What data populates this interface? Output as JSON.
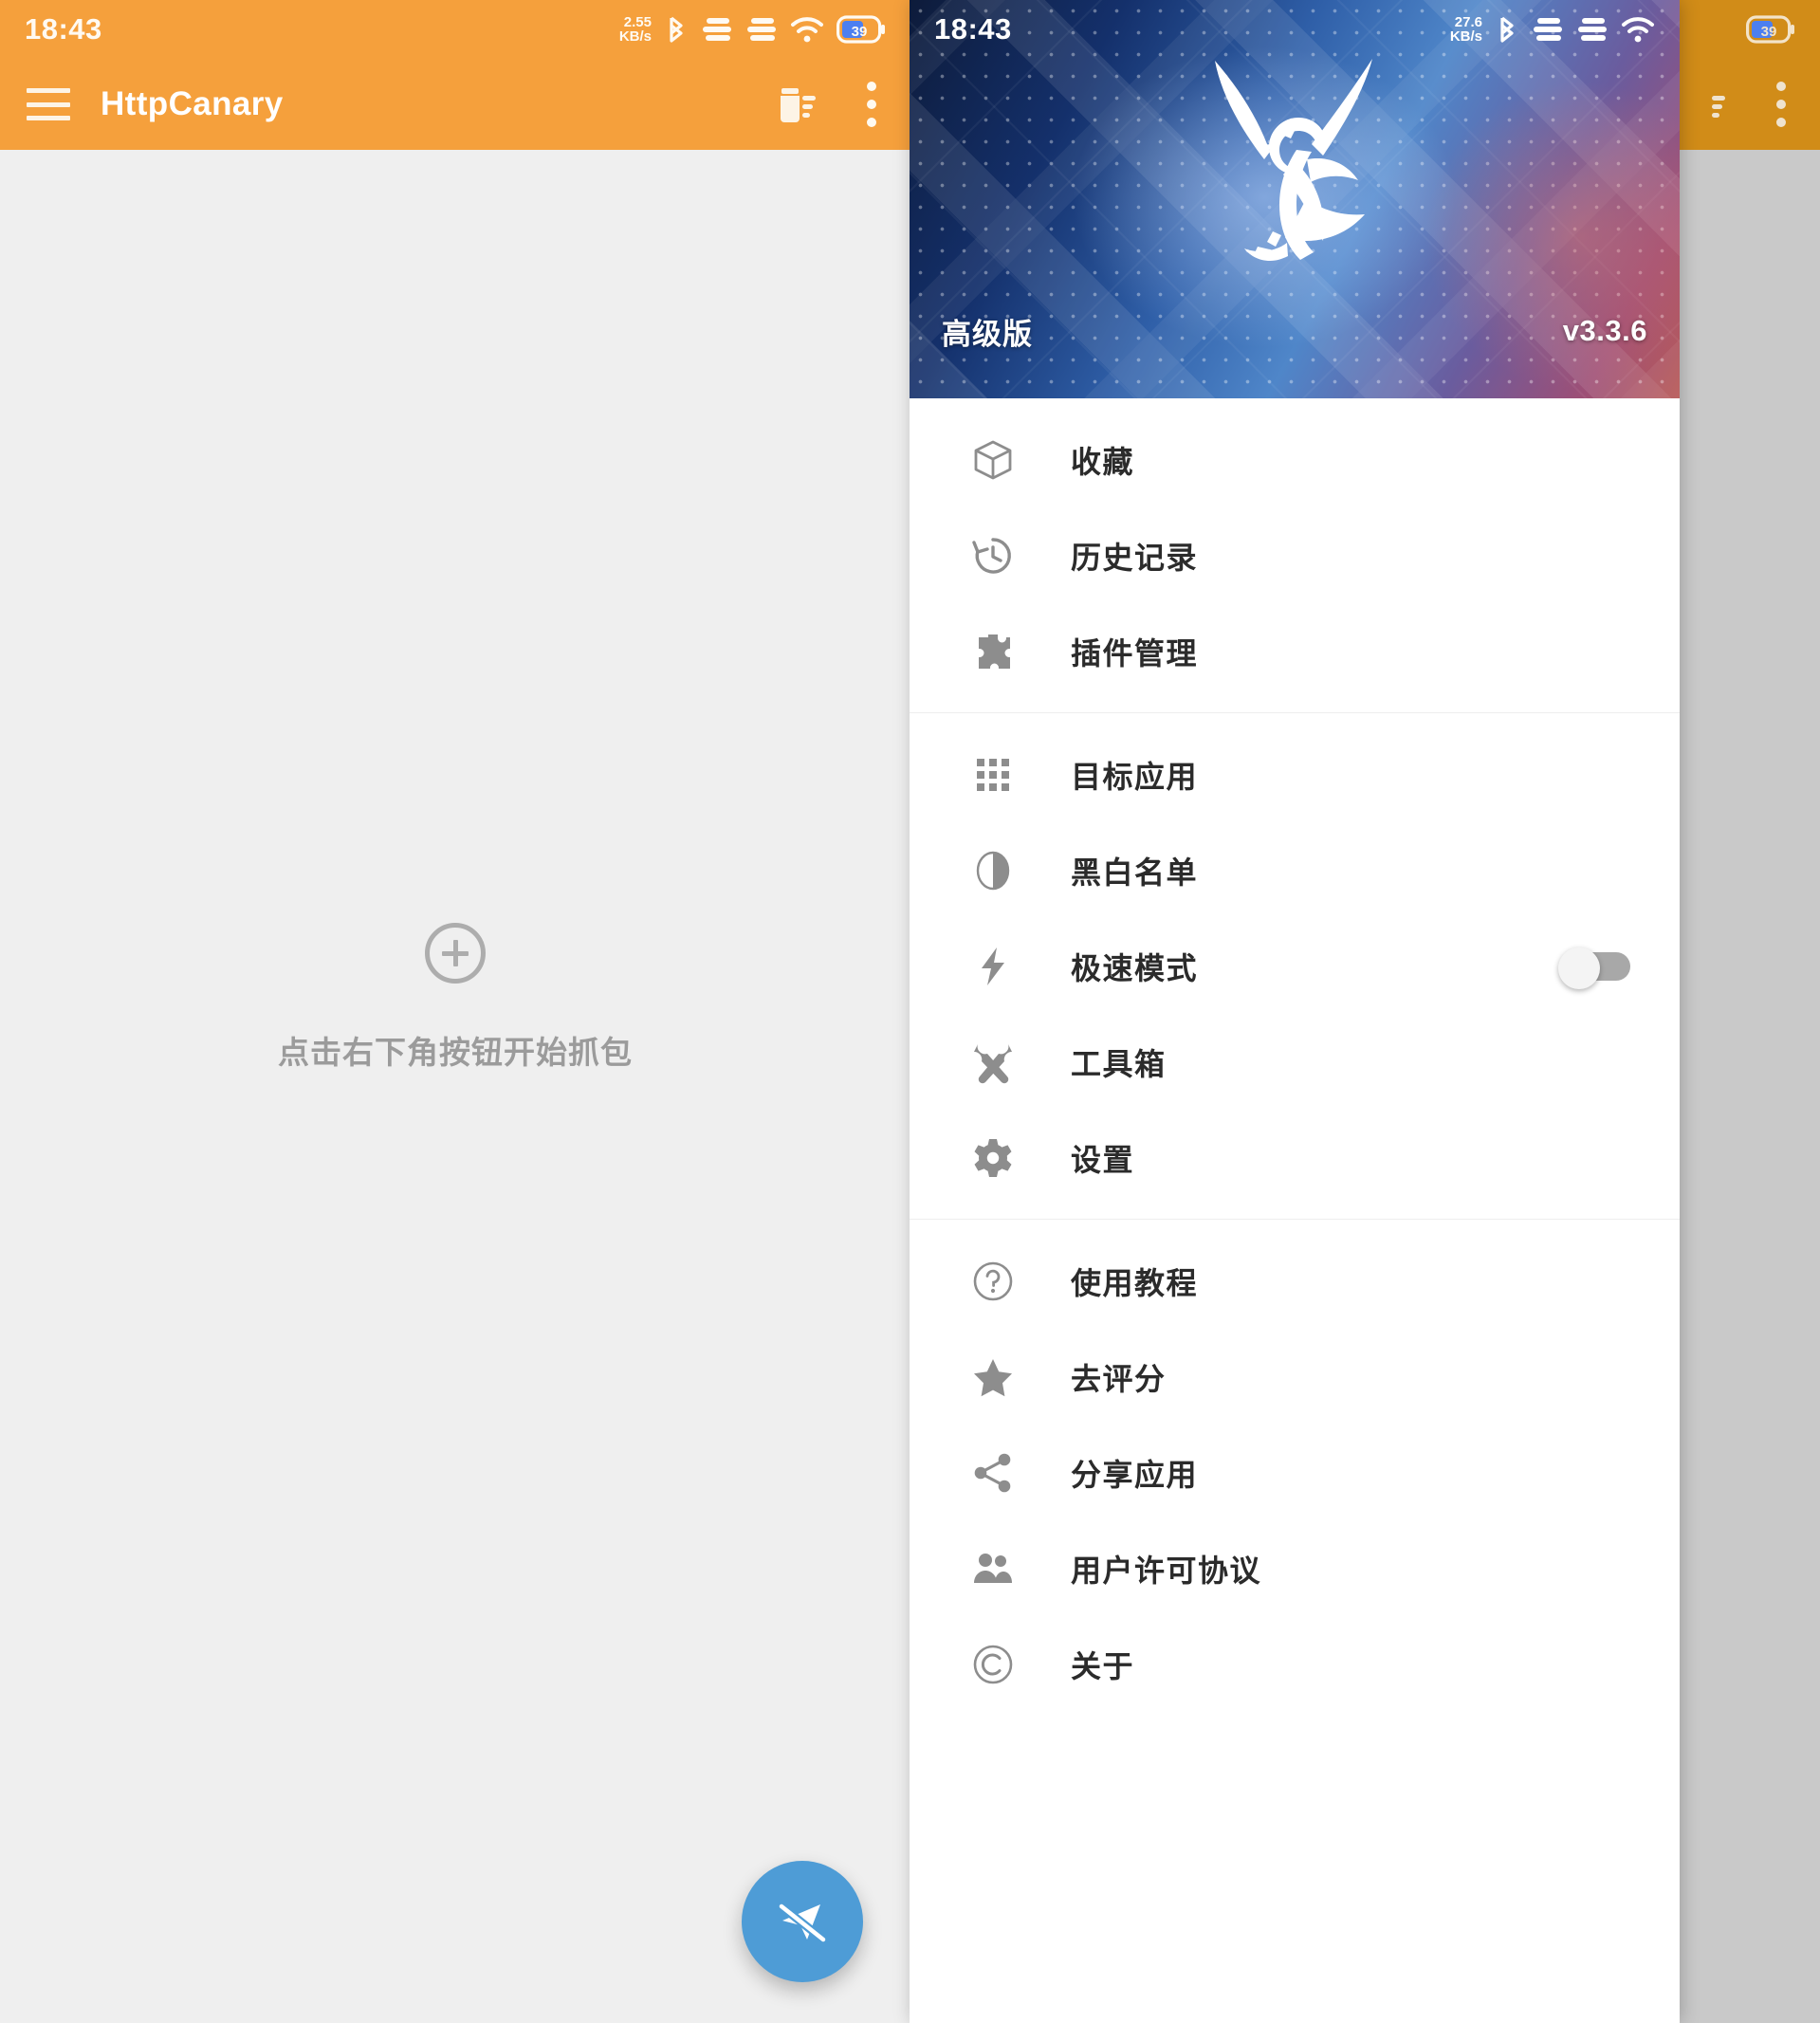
{
  "left_pane": {
    "status_bar": {
      "time": "18:43",
      "net_speed_value": "2.55",
      "net_speed_unit": "KB/s",
      "battery_level": "39",
      "icons": [
        "bluetooth-icon",
        "signal-bars-icon",
        "signal-bars-icon",
        "wifi-icon",
        "battery-icon"
      ]
    },
    "app_bar": {
      "menu_icon": "hamburger-menu-icon",
      "title": "HttpCanary",
      "actions": [
        "clear-list-icon",
        "overflow-menu-icon"
      ]
    },
    "empty_state": {
      "icon": "plus-circle-icon",
      "message": "点击右下角按钮开始抓包"
    },
    "fab": {
      "icon": "capture-off-icon",
      "color": "#4e9cd6"
    }
  },
  "right_pane": {
    "status_bar": {
      "time": "18:43",
      "net_speed_value": "27.6",
      "net_speed_unit": "KB/s",
      "battery_level": "39"
    },
    "app_bar": {
      "actions": [
        "clear-list-icon",
        "overflow-menu-icon"
      ]
    },
    "fab": {
      "icon": "capture-off-icon",
      "color": "#3f81b4"
    }
  },
  "drawer": {
    "header": {
      "logo": "eagle-logo-icon",
      "edition": "高级版",
      "version": "v3.3.6"
    },
    "groups": [
      {
        "items": [
          {
            "icon": "box-icon",
            "label": "收藏"
          },
          {
            "icon": "history-icon",
            "label": "历史记录"
          },
          {
            "icon": "puzzle-icon",
            "label": "插件管理"
          }
        ]
      },
      {
        "items": [
          {
            "icon": "grid-apps-icon",
            "label": "目标应用"
          },
          {
            "icon": "half-circle-icon",
            "label": "黑白名单"
          },
          {
            "icon": "lightning-icon",
            "label": "极速模式",
            "toggle": "off"
          },
          {
            "icon": "tools-icon",
            "label": "工具箱"
          },
          {
            "icon": "gear-icon",
            "label": "设置"
          }
        ]
      },
      {
        "items": [
          {
            "icon": "question-circle-icon",
            "label": "使用教程"
          },
          {
            "icon": "star-icon",
            "label": "去评分"
          },
          {
            "icon": "share-icon",
            "label": "分享应用"
          },
          {
            "icon": "people-icon",
            "label": "用户许可协议"
          },
          {
            "icon": "copyright-icon",
            "label": "关于"
          }
        ]
      }
    ]
  },
  "colors": {
    "accent_orange": "#f5a03c",
    "accent_orange_dim": "#d18c18",
    "fab_blue": "#4e9cd6",
    "content_bg": "#efefef",
    "scrim": "#c9c9c9"
  }
}
